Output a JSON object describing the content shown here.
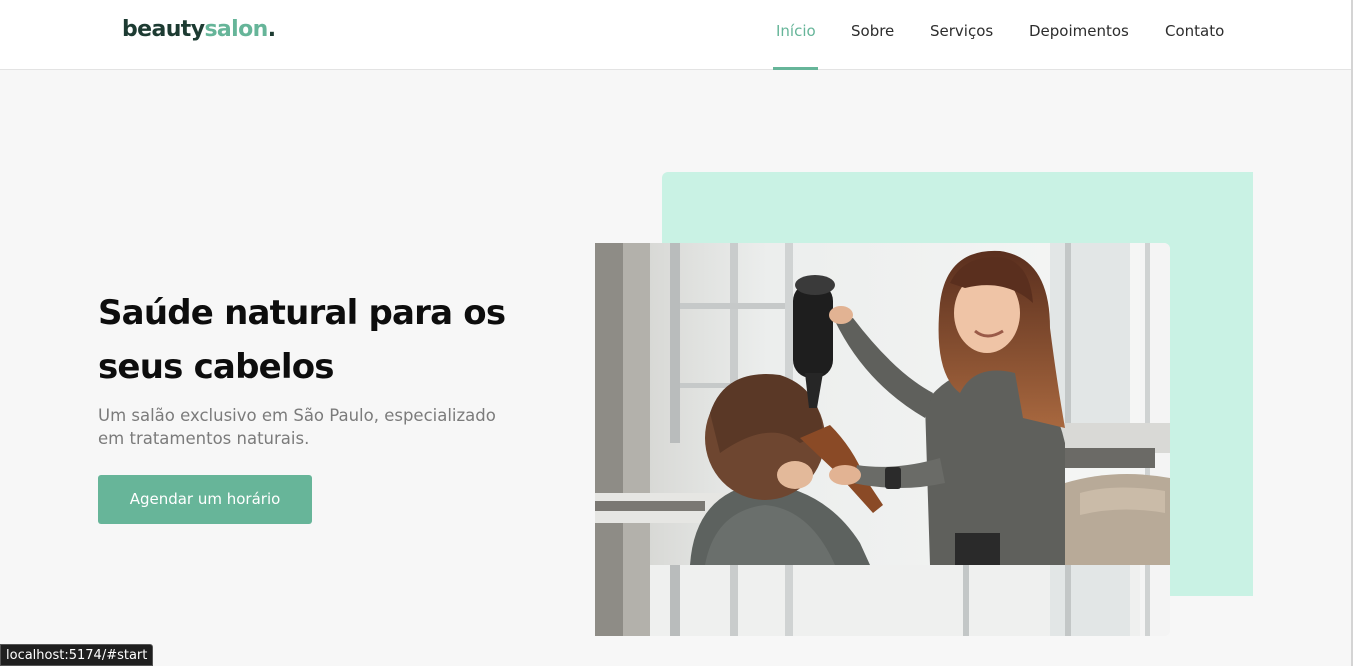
{
  "header": {
    "logo_main": "beauty",
    "logo_accent": "salon",
    "logo_dot": ".",
    "nav": [
      {
        "label": "Início",
        "active": true
      },
      {
        "label": "Sobre",
        "active": false
      },
      {
        "label": "Serviços",
        "active": false
      },
      {
        "label": "Depoimentos",
        "active": false
      },
      {
        "label": "Contato",
        "active": false
      }
    ]
  },
  "hero": {
    "title": "Saúde natural para os seus cabelos",
    "subtitle": "Um salão exclusivo em São Paulo, especializado em tratamentos naturais.",
    "cta_label": "Agendar um horário"
  },
  "status_bar": {
    "url": "localhost:5174/#start"
  },
  "colors": {
    "accent": "#66b599",
    "mint": "#c9f2e4",
    "text_dark": "#0d0d0d",
    "text_muted": "#7b7b7b"
  }
}
